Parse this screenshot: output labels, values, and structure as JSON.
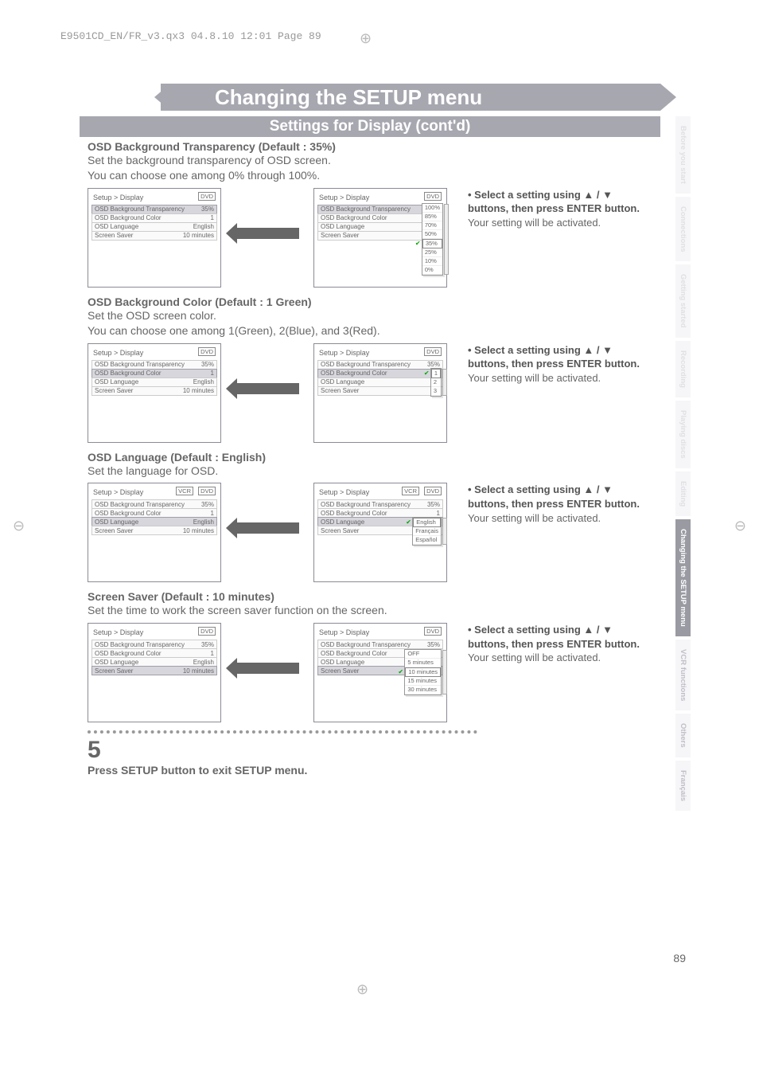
{
  "meta": {
    "header_line": "E9501CD_EN/FR_v3.qx3  04.8.10  12:01  Page 89"
  },
  "page": {
    "title": "Changing the SETUP menu",
    "subtitle": "Settings for Display (cont'd)",
    "number": "89"
  },
  "sections": {
    "transparency": {
      "heading": "OSD Background Transparency (Default : 35%)",
      "line1": "Set the background transparency of OSD screen.",
      "line2": "You can choose one among 0% through 100%."
    },
    "bgcolor": {
      "heading": "OSD Background Color (Default : 1 Green)",
      "line1": "Set the OSD screen color.",
      "line2": "You can choose one among 1(Green), 2(Blue), and 3(Red)."
    },
    "language": {
      "heading": "OSD Language (Default : English)",
      "line1": "Set the language for OSD."
    },
    "screensaver": {
      "heading": "Screen Saver (Default : 10 minutes)",
      "line1": "Set the time to work the screen saver function on the screen."
    }
  },
  "instruction": {
    "bullet1": "• Select a setting using ▲ / ▼ buttons, then press ENTER button.",
    "line2": "Your setting will be activated."
  },
  "osd": {
    "breadcrumb": "Setup > Display",
    "badge_dvd": "DVD",
    "badge_vcr": "VCR",
    "row_transparency": "OSD Background Transparency",
    "row_bgcolor": "OSD Background Color",
    "row_language": "OSD Language",
    "row_saver": "Screen Saver",
    "val_transparency": "35%",
    "val_bgcolor": "1",
    "val_language": "English",
    "val_saver": "10 minutes",
    "opts_transparency": [
      "100%",
      "85%",
      "70%",
      "50%",
      "35%",
      "25%",
      "10%",
      "0%"
    ],
    "opts_bgcolor": [
      "1",
      "2",
      "3"
    ],
    "opts_language": [
      "English",
      "Français",
      "Español"
    ],
    "opts_saver": [
      "OFF",
      "5 minutes",
      "10 minutes",
      "15 minutes",
      "30 minutes"
    ]
  },
  "step5": {
    "num": "5",
    "text": "Press SETUP button to exit SETUP menu."
  },
  "tabs": {
    "t1": "Before you start",
    "t2": "Connections",
    "t3": "Getting started",
    "t4": "Recording",
    "t5": "Playing discs",
    "t6": "Editing",
    "t7": "Changing the SETUP menu",
    "t8": "VCR functions",
    "t9": "Others",
    "t10": "Français"
  }
}
